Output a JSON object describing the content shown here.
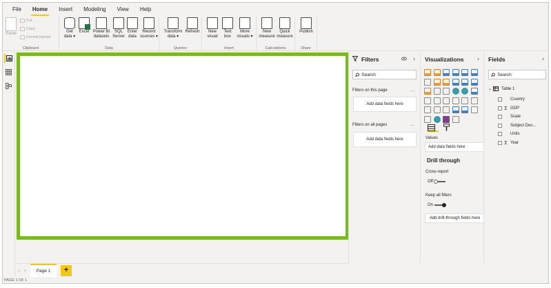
{
  "menu": [
    "File",
    "Home",
    "Insert",
    "Modeling",
    "View",
    "Help"
  ],
  "active_menu": "Home",
  "ribbon": {
    "clipboard": {
      "label": "Clipboard",
      "paste": "Paste",
      "cut": "Cut",
      "copy": "Copy",
      "format_painter": "Format painter"
    },
    "data": {
      "label": "Data",
      "get_data": [
        "Get",
        "data ▾"
      ],
      "excel": [
        "Excel",
        ""
      ],
      "power_bi": [
        "Power BI",
        "datasets"
      ],
      "sql": [
        "SQL",
        "Server"
      ],
      "enter": [
        "Enter",
        "data"
      ],
      "recent": [
        "Recent",
        "sources ▾"
      ]
    },
    "queries": {
      "label": "Queries",
      "transform": [
        "Transform",
        "data ▾"
      ],
      "refresh": [
        "Refresh",
        ""
      ]
    },
    "insert": {
      "label": "Insert",
      "new_visual": [
        "New",
        "visual"
      ],
      "text_box": [
        "Text",
        "box"
      ],
      "more_visuals": [
        "More",
        "visuals ▾"
      ]
    },
    "calculations": {
      "label": "Calculations",
      "new_measure": [
        "New",
        "measure"
      ],
      "quick_measure": [
        "Quick",
        "measure"
      ]
    },
    "share": {
      "label": "Share",
      "publish": [
        "Publish",
        ""
      ]
    }
  },
  "pages": {
    "tab": "Page 1",
    "add": "+",
    "status": "PAGE 1 OF 1"
  },
  "filters": {
    "title": "Filters",
    "search_placeholder": "Search",
    "on_this_page": "Filters on this page",
    "on_all_pages": "Filters on all pages",
    "add_fields": "Add data fields here",
    "more": "..."
  },
  "visualizations": {
    "title": "Visualizations",
    "values_label": "Values",
    "add_fields": "Add data fields here",
    "drill_through": "Drill through",
    "cross_report": "Cross-report",
    "cross_report_state": "Off",
    "keep_all_filters": "Keep all filters",
    "keep_all_filters_state": "On",
    "add_drill": "Add drill-through fields here",
    "accent_color": "#f2c811"
  },
  "fields": {
    "title": "Fields",
    "search_placeholder": "Search",
    "table": "Table 1",
    "items": [
      {
        "name": "Country",
        "sigma": false
      },
      {
        "name": "GDP",
        "sigma": true
      },
      {
        "name": "Scale",
        "sigma": false
      },
      {
        "name": "Subject Des...",
        "sigma": false
      },
      {
        "name": "Units",
        "sigma": false
      },
      {
        "name": "Year",
        "sigma": true
      }
    ]
  },
  "colors": {
    "highlight_border": "#7ab826",
    "accent": "#f2c811"
  }
}
